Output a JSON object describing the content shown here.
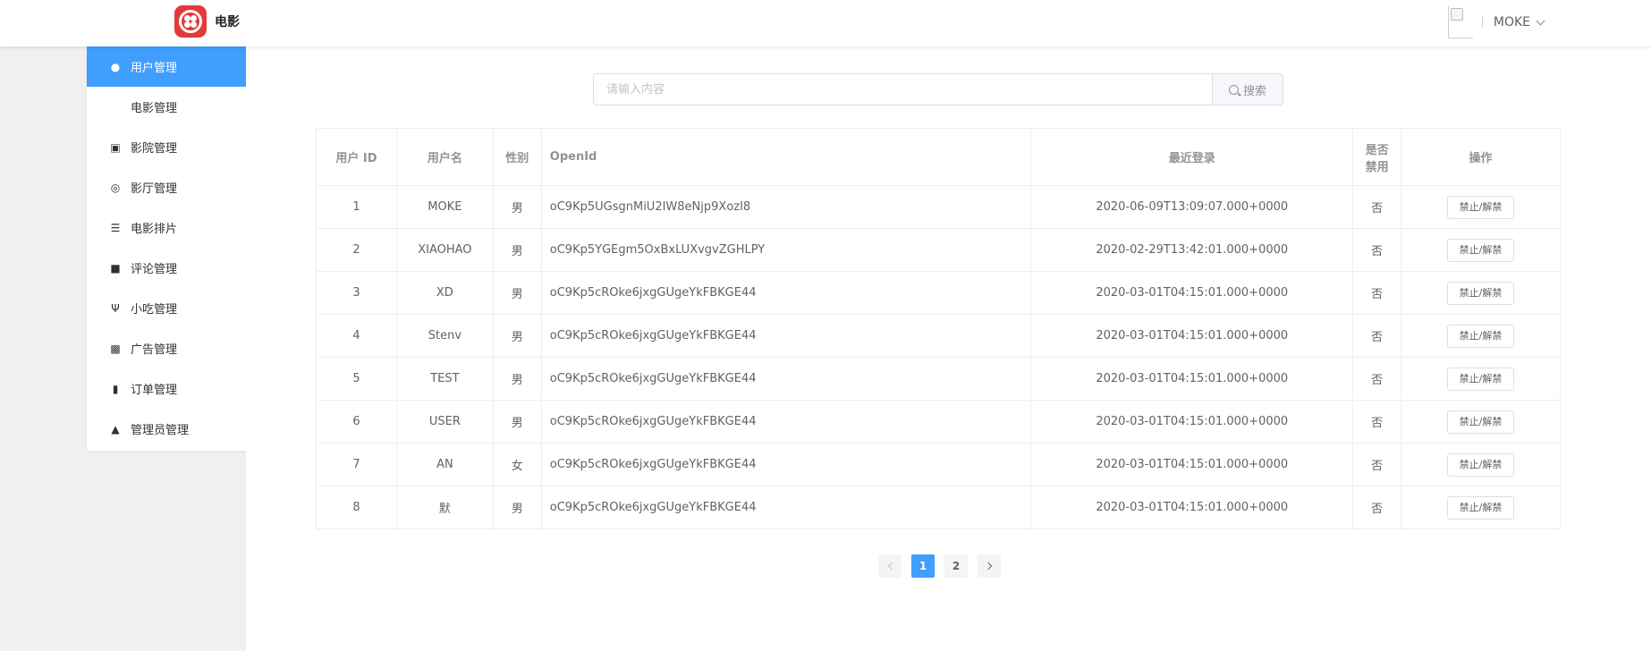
{
  "header": {
    "app_title": "电影",
    "username": "MOKE"
  },
  "sidebar": {
    "items": [
      {
        "label": "用户管理",
        "icon": "user-icon"
      },
      {
        "label": "电影管理",
        "icon": ""
      },
      {
        "label": "影院管理",
        "icon": "camera-icon"
      },
      {
        "label": "影厅管理",
        "icon": "hall-icon"
      },
      {
        "label": "电影排片",
        "icon": "list-icon"
      },
      {
        "label": "评论管理",
        "icon": "comment-icon"
      },
      {
        "label": "小吃管理",
        "icon": "fork-knife-icon"
      },
      {
        "label": "广告管理",
        "icon": "ad-icon"
      },
      {
        "label": "订单管理",
        "icon": "ticket-icon"
      },
      {
        "label": "管理员管理",
        "icon": "admin-icon"
      }
    ]
  },
  "search": {
    "placeholder": "请输入内容",
    "button_label": "搜索"
  },
  "table": {
    "columns": [
      "用户 ID",
      "用户名",
      "性别",
      "OpenId",
      "最近登录",
      "是否禁用",
      "操作"
    ],
    "col_disabled_line1": "是否",
    "col_disabled_line2": "禁用",
    "action_label": "禁止/解禁",
    "rows": [
      {
        "id": "1",
        "name": "MOKE",
        "gender": "男",
        "openid": "oC9Kp5UGsgnMiU2IW8eNjp9XozI8",
        "last_login": "2020-06-09T13:09:07.000+0000",
        "disabled": "否"
      },
      {
        "id": "2",
        "name": "XIAOHAO",
        "gender": "男",
        "openid": "oC9Kp5YGEgm5OxBxLUXvgvZGHLPY",
        "last_login": "2020-02-29T13:42:01.000+0000",
        "disabled": "否"
      },
      {
        "id": "3",
        "name": "XD",
        "gender": "男",
        "openid": "oC9Kp5cROke6jxgGUgeYkFBKGE44",
        "last_login": "2020-03-01T04:15:01.000+0000",
        "disabled": "否"
      },
      {
        "id": "4",
        "name": "Stenv",
        "gender": "男",
        "openid": "oC9Kp5cROke6jxgGUgeYkFBKGE44",
        "last_login": "2020-03-01T04:15:01.000+0000",
        "disabled": "否"
      },
      {
        "id": "5",
        "name": "TEST",
        "gender": "男",
        "openid": "oC9Kp5cROke6jxgGUgeYkFBKGE44",
        "last_login": "2020-03-01T04:15:01.000+0000",
        "disabled": "否"
      },
      {
        "id": "6",
        "name": "USER",
        "gender": "男",
        "openid": "oC9Kp5cROke6jxgGUgeYkFBKGE44",
        "last_login": "2020-03-01T04:15:01.000+0000",
        "disabled": "否"
      },
      {
        "id": "7",
        "name": "AN",
        "gender": "女",
        "openid": "oC9Kp5cROke6jxgGUgeYkFBKGE44",
        "last_login": "2020-03-01T04:15:01.000+0000",
        "disabled": "否"
      },
      {
        "id": "8",
        "name": "默",
        "gender": "男",
        "openid": "oC9Kp5cROke6jxgGUgeYkFBKGE44",
        "last_login": "2020-03-01T04:15:01.000+0000",
        "disabled": "否"
      }
    ]
  },
  "pagination": {
    "pages": [
      "1",
      "2"
    ],
    "current": "1"
  },
  "colors": {
    "accent": "#409eff",
    "logo": "#e23a3a"
  }
}
